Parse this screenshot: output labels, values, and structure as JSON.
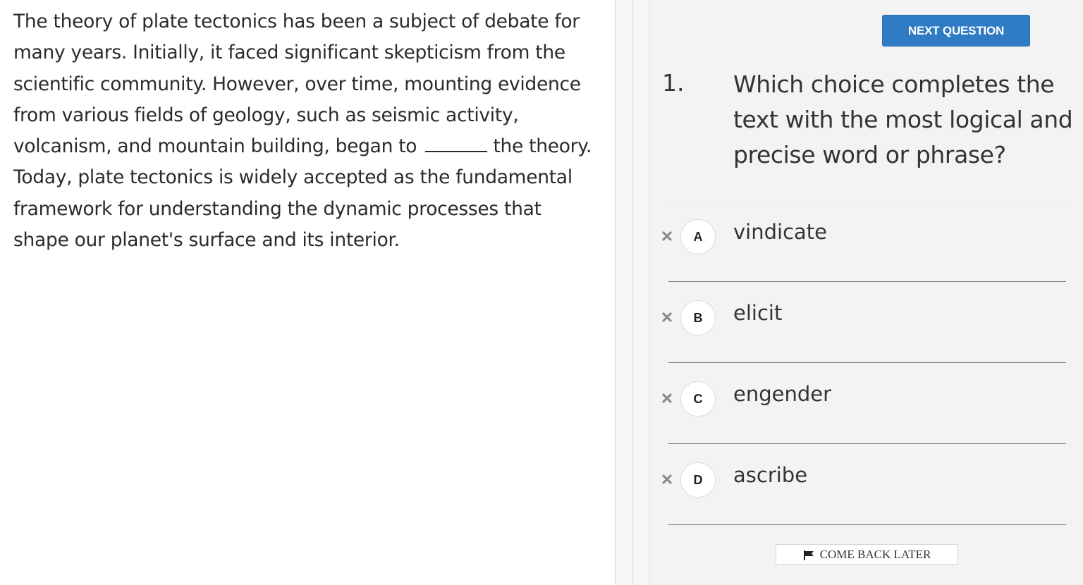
{
  "passage": {
    "before_blank": "The theory of plate tectonics has been a subject of debate for many years. Initially, it faced significant skepticism from the scientific community. However, over time, mounting evidence from various fields of geology, such as seismic activity, volcanism, and mountain building, began to",
    "after_blank": "the theory. Today, plate tectonics is widely accepted as the fundamental framework for understanding the dynamic processes that shape our planet's surface and its interior."
  },
  "header": {
    "next_label": "NEXT QUESTION"
  },
  "question": {
    "number": "1.",
    "text": "Which choice completes the text with the most logical and precise word or phrase?"
  },
  "choices": [
    {
      "letter": "A",
      "text": "vindicate"
    },
    {
      "letter": "B",
      "text": "elicit"
    },
    {
      "letter": "C",
      "text": "engender"
    },
    {
      "letter": "D",
      "text": "ascribe"
    }
  ],
  "icons": {
    "eliminate": "close-icon",
    "flag": "flag-icon"
  },
  "footer": {
    "come_back_label": "COME BACK LATER"
  },
  "colors": {
    "accent": "#2f7bc4",
    "pane_bg": "#f3f3f3"
  }
}
